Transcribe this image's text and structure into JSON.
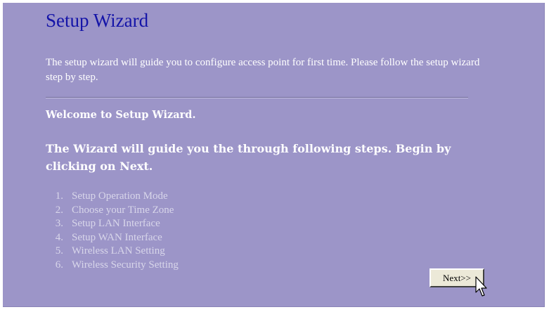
{
  "page": {
    "title": "Setup Wizard",
    "intro": "The setup wizard will guide you to configure access point for first time. Please follow the setup wizard step by step.",
    "welcome": "Welcome to Setup Wizard.",
    "guide": "The Wizard will guide you the through following steps. Begin by clicking on Next."
  },
  "steps": [
    {
      "num": "1.",
      "label": "Setup Operation Mode"
    },
    {
      "num": "2.",
      "label": "Choose your Time Zone"
    },
    {
      "num": "3.",
      "label": "Setup LAN Interface"
    },
    {
      "num": "4.",
      "label": "Setup WAN Interface"
    },
    {
      "num": "5.",
      "label": "Wireless LAN Setting"
    },
    {
      "num": "6.",
      "label": "Wireless Security Setting"
    }
  ],
  "buttons": {
    "next_label": "Next>>"
  },
  "colors": {
    "background": "#9c95c8",
    "title": "#1414a8",
    "text": "#ffffff"
  },
  "icons": {
    "cursor": "mouse-pointer-icon"
  }
}
